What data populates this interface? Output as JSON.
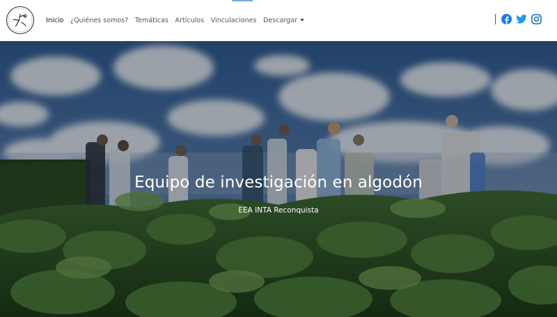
{
  "nav": {
    "items": [
      {
        "label": "Inicio",
        "active": true
      },
      {
        "label": "¿Quiénes somos?"
      },
      {
        "label": "Temáticas"
      },
      {
        "label": "Artículos"
      },
      {
        "label": "Vinculaciones"
      },
      {
        "label": "Descargar"
      }
    ],
    "social": [
      "facebook-icon",
      "twitter-icon",
      "instagram-icon"
    ]
  },
  "hero": {
    "title": "Equipo de investigación en algodón",
    "subtitle": "EEA INTA Reconquista"
  },
  "colors": {
    "facebook": "#1877f2",
    "twitter": "#1d9bf0",
    "instagram": "#0a66c2"
  }
}
